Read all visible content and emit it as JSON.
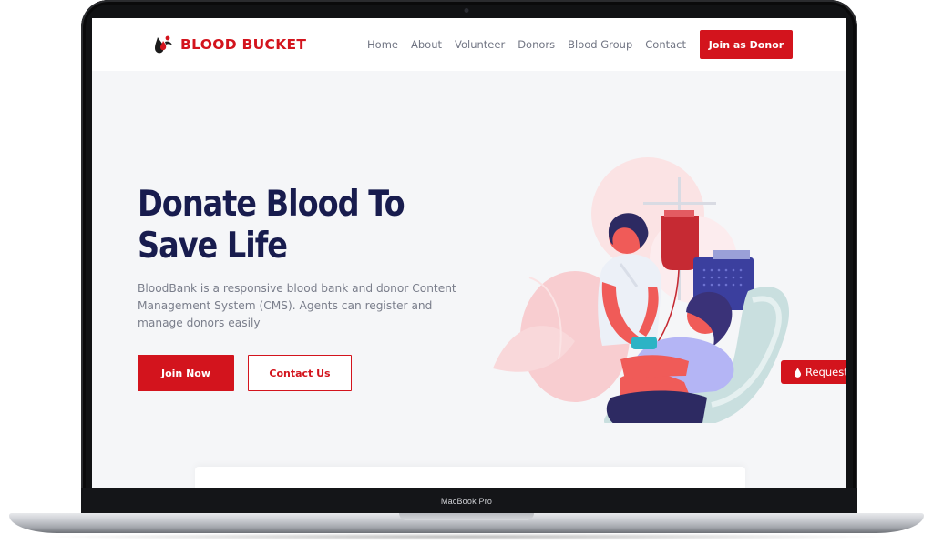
{
  "device": {
    "model_label": "MacBook Pro"
  },
  "brand": {
    "name": "BLOOD BUCKET",
    "icon": "blood-drop-person-icon",
    "color": "#d3141d"
  },
  "nav": {
    "links": [
      "Home",
      "About",
      "Volunteer",
      "Donors",
      "Blood Group",
      "Contact"
    ],
    "cta_label": "Join as Donor"
  },
  "hero": {
    "title_line1": "Donate Blood To",
    "title_line2": "Save Life",
    "description": "BloodBank is a responsive blood bank and donor Content Management System (CMS). Agents can register and manage donors easily",
    "primary_button": "Join Now",
    "secondary_button": "Contact Us",
    "illustration": "nurse-drawing-blood-from-donor-illustration"
  },
  "request_tab": {
    "label": "Request",
    "icon": "blood-drop-icon"
  },
  "colors": {
    "accent": "#d3141d",
    "heading": "#181c4e",
    "text": "#7a7e8b",
    "background": "#f5f6f8"
  }
}
